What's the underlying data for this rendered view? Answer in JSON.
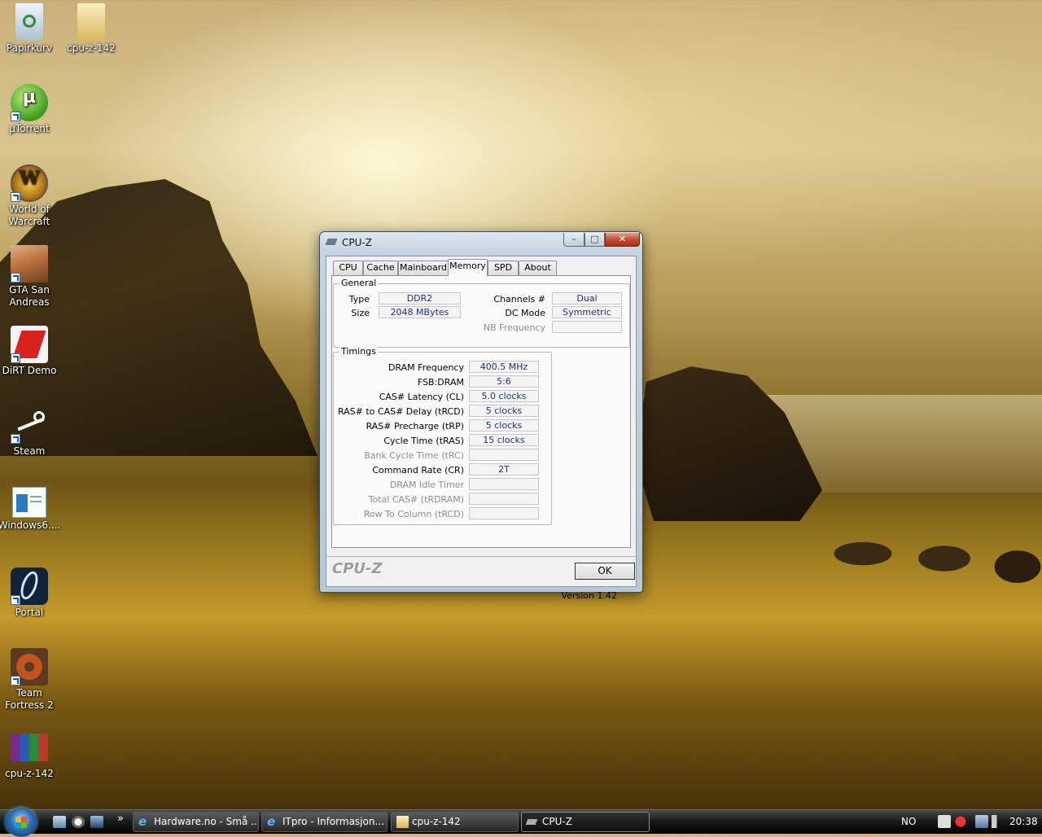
{
  "desktop": {
    "icons": [
      {
        "label": "Papirkurv",
        "icon": "recycle-bin-icon"
      },
      {
        "label": "cpu-z-142",
        "icon": "folder-icon"
      },
      {
        "label": "µTorrent",
        "icon": "utorrent-icon"
      },
      {
        "label": "World of Warcraft",
        "icon": "wow-icon"
      },
      {
        "label": "GTA San Andreas",
        "icon": "gta-icon"
      },
      {
        "label": "DiRT Demo",
        "icon": "dirt-icon"
      },
      {
        "label": "Steam",
        "icon": "steam-icon"
      },
      {
        "label": "Windows6....",
        "icon": "windows-update-icon"
      },
      {
        "label": "Portal",
        "icon": "portal-icon"
      },
      {
        "label": "Team Fortress 2",
        "icon": "tf2-icon"
      },
      {
        "label": "cpu-z-142",
        "icon": "rar-archive-icon"
      }
    ]
  },
  "window": {
    "title": "CPU-Z",
    "controls": {
      "minimize": "–",
      "maximize": "□",
      "close": "✕"
    },
    "tabs": [
      "CPU",
      "Cache",
      "Mainboard",
      "Memory",
      "SPD",
      "About"
    ],
    "active_tab": "Memory",
    "general": {
      "legend": "General",
      "type_label": "Type",
      "type_value": "DDR2",
      "size_label": "Size",
      "size_value": "2048 MBytes",
      "channels_label": "Channels #",
      "channels_value": "Dual",
      "dcmode_label": "DC Mode",
      "dcmode_value": "Symmetric",
      "nbfreq_label": "NB Frequency",
      "nbfreq_value": ""
    },
    "timings": {
      "legend": "Timings",
      "rows": [
        {
          "label": "DRAM Frequency",
          "value": "400.5 MHz",
          "enabled": true
        },
        {
          "label": "FSB:DRAM",
          "value": "5:6",
          "enabled": true
        },
        {
          "label": "CAS# Latency (CL)",
          "value": "5.0 clocks",
          "enabled": true
        },
        {
          "label": "RAS# to CAS# Delay (tRCD)",
          "value": "5 clocks",
          "enabled": true
        },
        {
          "label": "RAS# Precharge (tRP)",
          "value": "5 clocks",
          "enabled": true
        },
        {
          "label": "Cycle Time (tRAS)",
          "value": "15 clocks",
          "enabled": true
        },
        {
          "label": "Bank Cycle Time (tRC)",
          "value": "",
          "enabled": false
        },
        {
          "label": "Command Rate (CR)",
          "value": "2T",
          "enabled": true
        },
        {
          "label": "DRAM Idle Timer",
          "value": "",
          "enabled": false
        },
        {
          "label": "Total CAS# (tRDRAM)",
          "value": "",
          "enabled": false
        },
        {
          "label": "Row To Column (tRCD)",
          "value": "",
          "enabled": false
        }
      ]
    },
    "version": "Version 1.42",
    "brand": "CPU-Z",
    "ok_label": "OK"
  },
  "taskbar": {
    "quicklaunch_more": "»",
    "tasks": [
      {
        "label": "Hardware.no - Små ...",
        "icon": "ie-icon"
      },
      {
        "label": "ITpro - Informasjon...",
        "icon": "ie-icon"
      },
      {
        "label": "cpu-z-142",
        "icon": "folder-icon"
      },
      {
        "label": "CPU-Z",
        "icon": "cpuz-icon"
      }
    ],
    "language": "NO",
    "clock": "20:38"
  }
}
